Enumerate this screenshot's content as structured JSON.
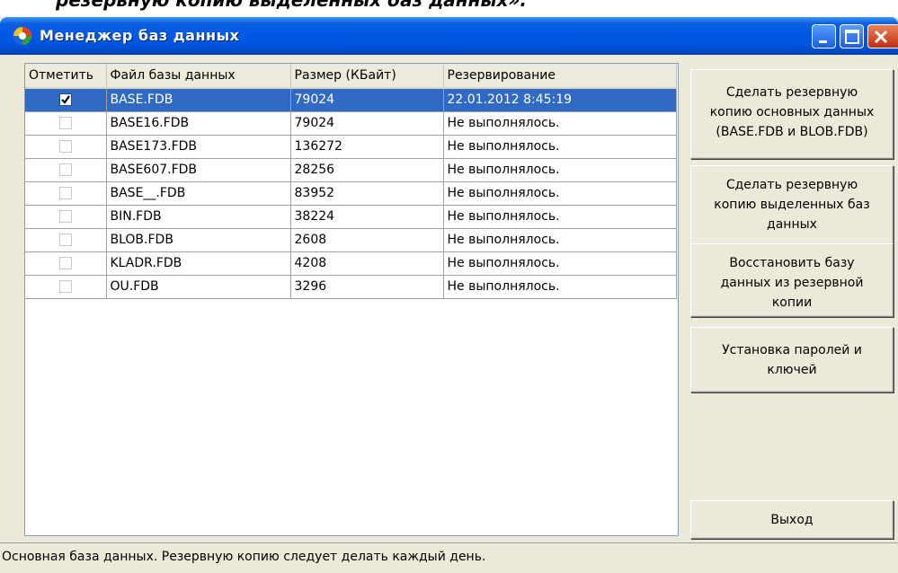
{
  "caption_text": "резервную копию выделенных баз данных».",
  "window": {
    "title": "Менеджер баз данных"
  },
  "table": {
    "headers": [
      "Отметить",
      "Файл базы данных",
      "Размер (КБайт)",
      "Резервирование"
    ],
    "rows": [
      {
        "checked": true,
        "file": "BASE.FDB",
        "size": "79024",
        "backup": "22.01.2012 8:45:19",
        "selected": true
      },
      {
        "checked": false,
        "file": "BASE16.FDB",
        "size": "79024",
        "backup": "Не выполнялось.",
        "selected": false
      },
      {
        "checked": false,
        "file": "BASE173.FDB",
        "size": "136272",
        "backup": "Не выполнялось.",
        "selected": false
      },
      {
        "checked": false,
        "file": "BASE607.FDB",
        "size": "28256",
        "backup": "Не выполнялось.",
        "selected": false
      },
      {
        "checked": false,
        "file": "BASE__.FDB",
        "size": "83952",
        "backup": "Не выполнялось.",
        "selected": false
      },
      {
        "checked": false,
        "file": "BIN.FDB",
        "size": "38224",
        "backup": "Не выполнялось.",
        "selected": false
      },
      {
        "checked": false,
        "file": "BLOB.FDB",
        "size": "2608",
        "backup": "Не выполнялось.",
        "selected": false
      },
      {
        "checked": false,
        "file": "KLADR.FDB",
        "size": "4208",
        "backup": "Не выполнялось.",
        "selected": false
      },
      {
        "checked": false,
        "file": "OU.FDB",
        "size": "3296",
        "backup": "Не выполнялось.",
        "selected": false
      }
    ]
  },
  "buttons": {
    "backup_main": [
      "Сделать резервную",
      "копию основных данных",
      "(BASE.FDB и BLOB.FDB)"
    ],
    "backup_selected": [
      "Сделать резервную",
      "копию выделенных баз",
      "данных"
    ],
    "restore": [
      "Восстановить базу",
      "данных из резервной",
      "копии"
    ],
    "passwords": [
      "Установка паролей и",
      "ключей"
    ],
    "exit": "Выход"
  },
  "status_text": "Основная база данных. Резервную копию следует делать каждый день.",
  "colors": {
    "title_bar": "#0058e6",
    "selection": "#316ac5",
    "window_bg": "#ece9d8"
  }
}
